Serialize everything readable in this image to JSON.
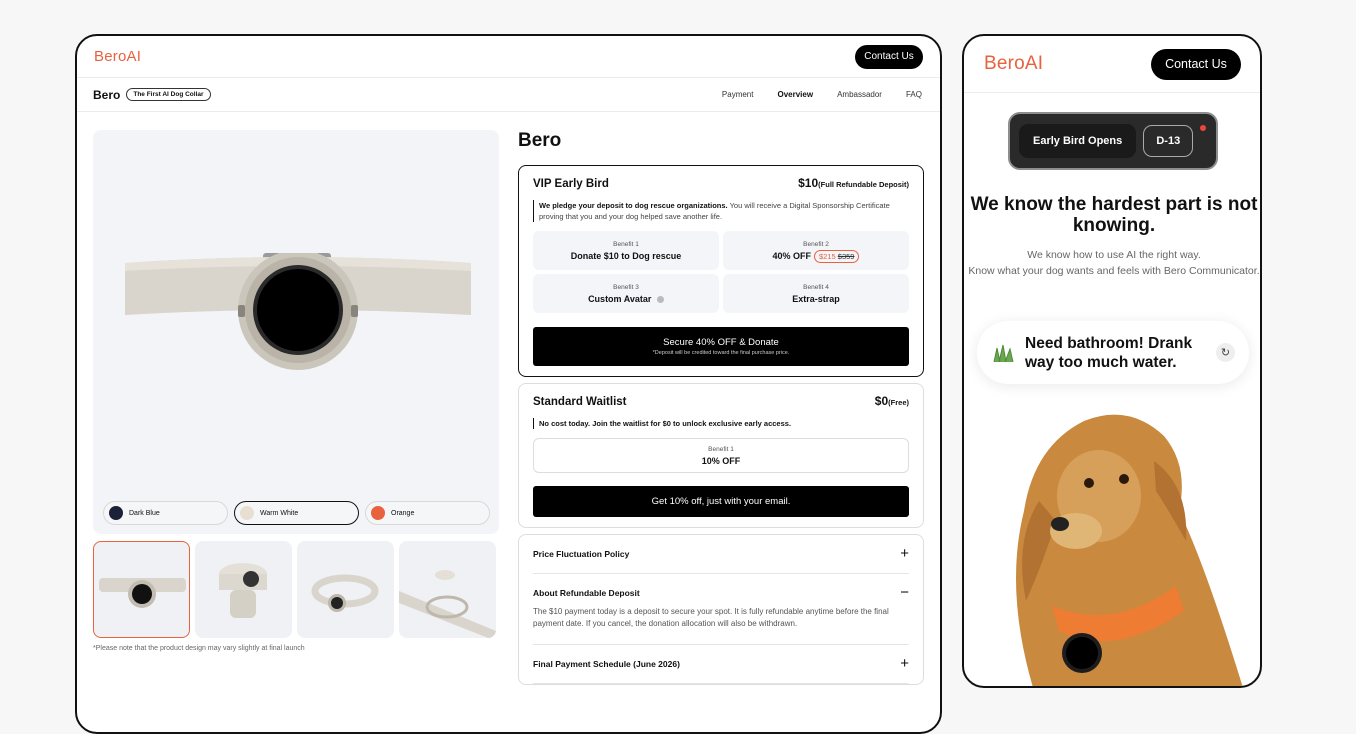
{
  "desktop": {
    "logo": "BeroAI",
    "contact_label": "Contact Us",
    "brand": "Bero",
    "tagline": "The First AI Dog Collar",
    "nav": [
      "Payment",
      "Overview",
      "Ambassador",
      "FAQ"
    ],
    "swatches": [
      {
        "label": "Dark Blue",
        "color": "#1b2238"
      },
      {
        "label": "Warm White",
        "color": "#e6dfd2"
      },
      {
        "label": "Orange",
        "color": "#e8623f"
      }
    ],
    "note": "*Please note that the product design may vary slightly at final launch",
    "product_title": "Bero",
    "vip": {
      "title": "VIP Early Bird",
      "price": "$10",
      "price_note": "(Full Refundable Deposit)",
      "desc_bold": "We pledge your deposit to dog rescue organizations.",
      "desc_rest": " You will receive a Digital Sponsorship Certificate proving that you and your dog helped save another life.",
      "benefits": [
        {
          "label": "Benefit 1",
          "value": "Donate $10 to Dog rescue"
        },
        {
          "label": "Benefit 2",
          "value": "40% OFF",
          "new_price": "$215",
          "old_price": "$359"
        },
        {
          "label": "Benefit 3",
          "value": "Custom Avatar"
        },
        {
          "label": "Benefit 4",
          "value": "Extra-strap"
        }
      ],
      "cta": "Secure 40% OFF & Donate",
      "cta_sub": "*Deposit will be credited toward the final purchase price."
    },
    "standard": {
      "title": "Standard Waitlist",
      "price": "$0",
      "price_note": "(Free)",
      "desc": "No cost today. Join the waitlist for $0 to unlock exclusive early access.",
      "benefit_label": "Benefit 1",
      "benefit_value": "10% OFF",
      "cta": "Get 10% off, just with your email."
    },
    "faq": [
      {
        "q": "Price Fluctuation Policy",
        "sign": "+"
      },
      {
        "q": "About Refundable Deposit",
        "sign": "−",
        "a": "The $10 payment today is a deposit to secure your spot. It is fully refundable anytime before the final payment date. If you cancel, the donation allocation will also be withdrawn."
      },
      {
        "q": "Final Payment Schedule (June 2026)",
        "sign": "+"
      }
    ]
  },
  "mobile": {
    "logo": "BeroAI",
    "contact_label": "Contact Us",
    "badge_left": "Early Bird Opens",
    "badge_right": "D-13",
    "headline": "We know the hardest part is not knowing.",
    "sub_1": "We know how to use AI the right way.",
    "sub_2": "Know what your dog wants and feels with Bero Communicator.",
    "bubble": "Need bathroom! Drank way too much water."
  }
}
